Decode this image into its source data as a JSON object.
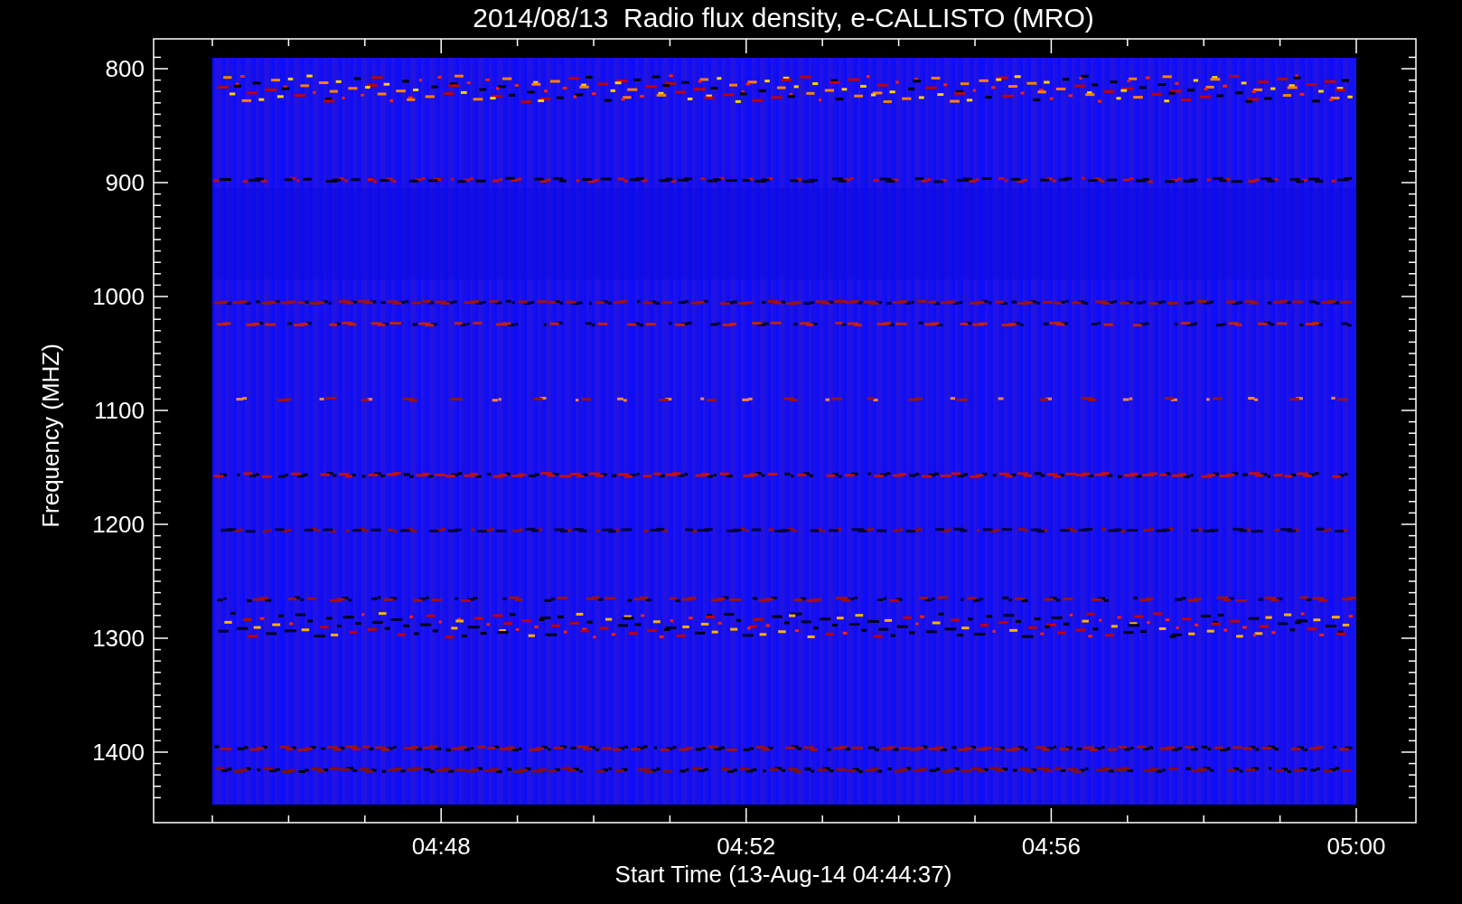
{
  "title": "2014/08/13  Radio flux density, e-CALLISTO (MRO)",
  "y_axis": {
    "label": "Frequency (MHZ)",
    "ticks": [
      "800",
      "900",
      "1000",
      "1100",
      "1200",
      "1300",
      "1400"
    ]
  },
  "x_axis": {
    "label": "Start Time (13-Aug-14 04:44:37)",
    "ticks": [
      "04:48",
      "04:52",
      "04:56",
      "05:00"
    ]
  }
}
